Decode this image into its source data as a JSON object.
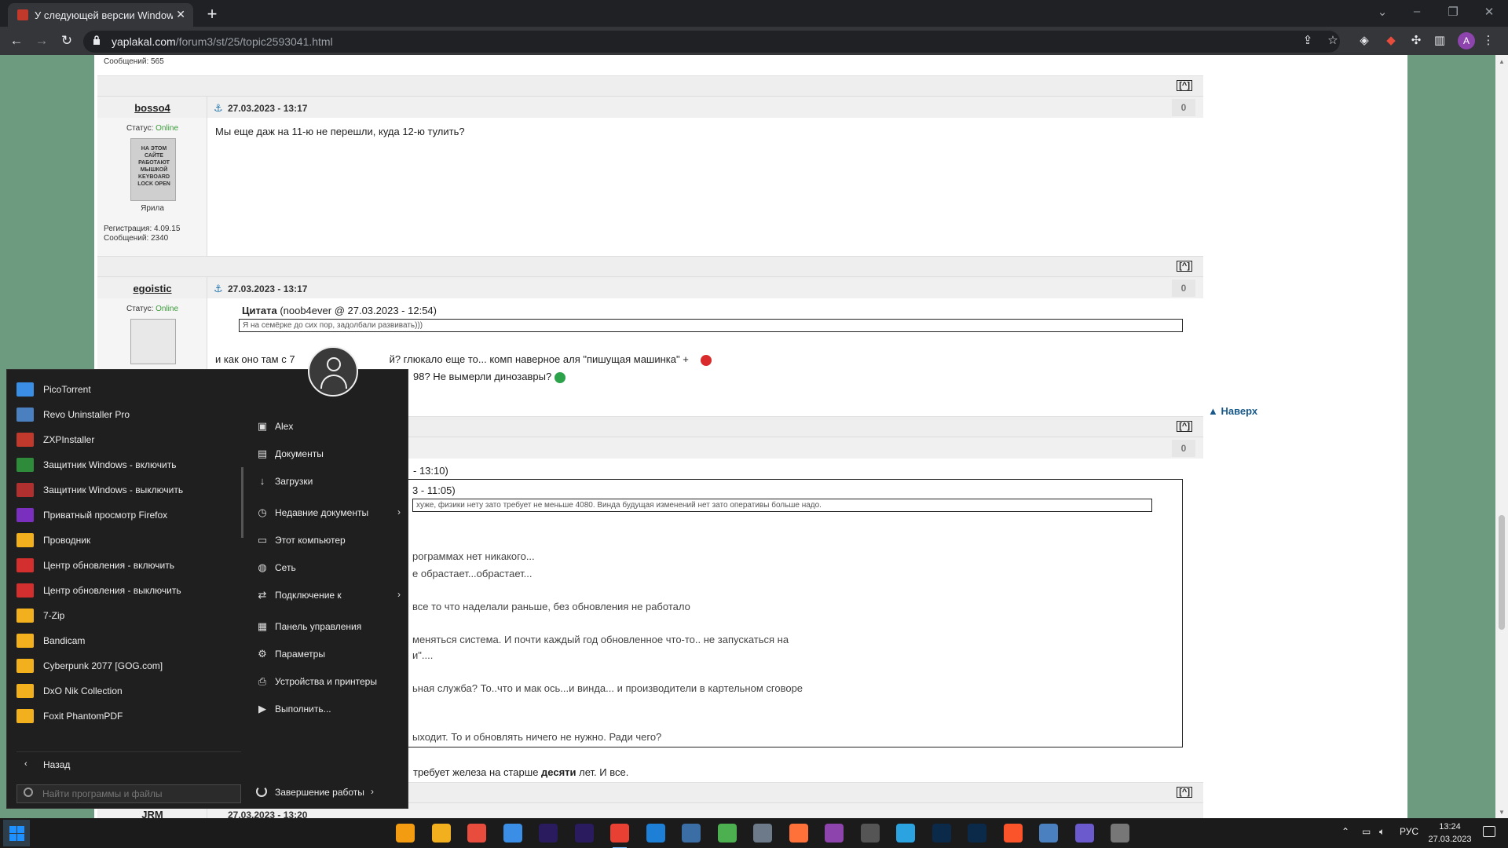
{
  "browser": {
    "tab_title": "У следующей версии Windows",
    "url_host": "yaplakal.com",
    "url_path": "/forum3/st/25/topic2593041.html",
    "profile_initial": "A"
  },
  "forum": {
    "prev_msg_count": "Сообщений: 565",
    "top_link": "[^]",
    "naverh": "Наверх",
    "posts": [
      {
        "author": "bosso4",
        "date": "27.03.2023 - 13:17",
        "rating": "0",
        "status_label": "Статус:",
        "status_value": "Online",
        "avatar_text": "НА ЭТОМ САЙТЕ РАБОТАЮТ МЫШКОЙ KEYBOARD LOCK OPEN",
        "caption": "Ярила",
        "reg": "Регистрация: 4.09.15",
        "msgs": "Сообщений: 2340",
        "text": "Мы еще даж на 11-ю не перешли, куда 12-ю тулить?"
      },
      {
        "author": "egoistic",
        "date": "27.03.2023 - 13:17",
        "rating": "0",
        "status_label": "Статус:",
        "status_value": "Online",
        "quote_title": "Цитата",
        "quote_meta": "(noob4ever @ 27.03.2023 - 12:54)",
        "quote_text": "Я на семёрке до сих пор, задолбали развивать)))",
        "line1": "и как оно там с 7",
        "line1b": "й? глюкало еще то... комп наверное аля \"пишущая машинка\" +",
        "line2": "98? Не вымерли динозавры?"
      },
      {
        "rating": "0",
        "quote_meta": "- 13:10)",
        "inner_quote_meta": "3 - 11:05)",
        "inner_quote_text": "хуже, физики нету зато требует не меньше 4080. Винда будущая изменений нет зато оперативы больше надо.",
        "lines": [
          "рограммах нет никакого...",
          "е обрастает...обрастает...",
          "все то что наделали раньше, без обновления не работало",
          "меняться система. И почти каждый год обновленное что-то.. не запускаться на",
          "и\"....",
          "ьная служба? То..что и мак ось...и винда... и производители в картельном сговоре",
          "ыходит. То и обновлять ничего не нужно. Ради чего?"
        ],
        "tail_pre": "требует железа на старше ",
        "tail_bold": "десяти",
        "tail_post": " лет. И все."
      }
    ],
    "next_post_author_partial": "JRM",
    "next_post_date_partial": "27.03.2023 - 13:20"
  },
  "startmenu": {
    "apps": [
      {
        "label": "PicoTorrent",
        "color": "#3a8ee6"
      },
      {
        "label": "Revo Uninstaller Pro",
        "color": "#4a7fc0"
      },
      {
        "label": "ZXPInstaller",
        "color": "#c0392b"
      },
      {
        "label": "Защитник Windows - включить",
        "color": "#2e8b3a"
      },
      {
        "label": "Защитник Windows - выключить",
        "color": "#b03030"
      },
      {
        "label": "Приватный просмотр Firefox",
        "color": "#7b2fbe"
      },
      {
        "label": "Проводник",
        "color": "#f2b01e"
      },
      {
        "label": "Центр обновления - включить",
        "color": "#d32f2f"
      },
      {
        "label": "Центр обновления - выключить",
        "color": "#d32f2f"
      },
      {
        "label": "7-Zip",
        "color": "#f2b01e"
      },
      {
        "label": "Bandicam",
        "color": "#f2b01e"
      },
      {
        "label": "Cyberpunk 2077 [GOG.com]",
        "color": "#f2b01e"
      },
      {
        "label": "DxO Nik Collection",
        "color": "#f2b01e"
      },
      {
        "label": "Foxit PhantomPDF",
        "color": "#f2b01e"
      }
    ],
    "back": "Назад",
    "search_placeholder": "Найти программы и файлы",
    "right_items": [
      {
        "label": "Alex",
        "icon": "folder-user-icon",
        "glyph": "▣",
        "chevron": false
      },
      {
        "label": "Документы",
        "icon": "document-icon",
        "glyph": "▤",
        "chevron": false
      },
      {
        "label": "Загрузки",
        "icon": "download-icon",
        "glyph": "↓",
        "chevron": false
      },
      {
        "label": "Недавние документы",
        "icon": "clock-icon",
        "glyph": "◷",
        "chevron": true
      },
      {
        "label": "Этот компьютер",
        "icon": "computer-icon",
        "glyph": "▭",
        "chevron": false
      },
      {
        "label": "Сеть",
        "icon": "network-icon",
        "glyph": "◍",
        "chevron": false
      },
      {
        "label": "Подключение к",
        "icon": "connect-icon",
        "glyph": "⇄",
        "chevron": true
      },
      {
        "label": "Панель управления",
        "icon": "control-panel-icon",
        "glyph": "▦",
        "chevron": false
      },
      {
        "label": "Параметры",
        "icon": "gear-icon",
        "glyph": "⚙",
        "chevron": false
      },
      {
        "label": "Устройства и принтеры",
        "icon": "printer-icon",
        "glyph": "⎙",
        "chevron": false
      },
      {
        "label": "Выполнить...",
        "icon": "run-icon",
        "glyph": "▶",
        "chevron": false
      }
    ],
    "shutdown": "Завершение работы"
  },
  "taskbar": {
    "lang": "РУС",
    "time": "13:24",
    "date": "27.03.2023"
  }
}
